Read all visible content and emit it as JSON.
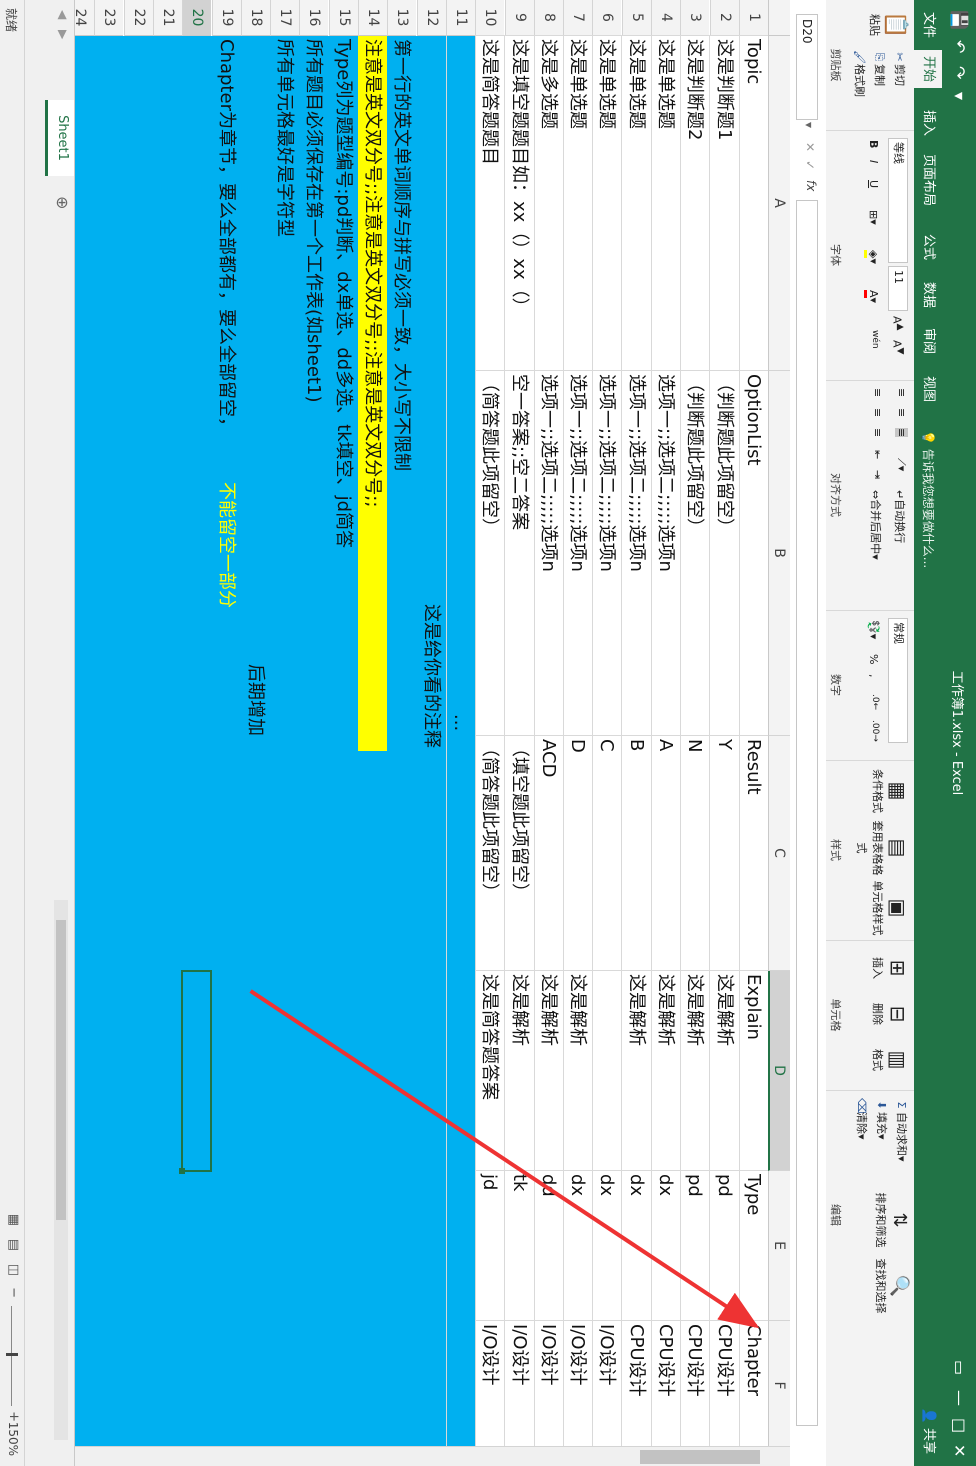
{
  "window": {
    "title": "工作簿1.xlsx - Excel",
    "share_label": "共享"
  },
  "tabs": [
    "文件",
    "开始",
    "插入",
    "页面布局",
    "公式",
    "数据",
    "审阅",
    "视图"
  ],
  "tell_me": "告诉我您想要做什么...",
  "ribbon": {
    "clipboard": {
      "paste": "粘贴",
      "cut": "剪切",
      "copy": "复制",
      "format_painter": "格式刷",
      "label": "剪贴板"
    },
    "font": {
      "name": "等线",
      "size": "11",
      "label": "字体",
      "bold": "B",
      "italic": "I",
      "underline": "U",
      "wen": "wén"
    },
    "alignment": {
      "wrap": "自动换行",
      "merge": "合并后居中",
      "label": "对齐方式"
    },
    "number": {
      "format": "常规",
      "label": "数字"
    },
    "styles": {
      "conditional": "条件格式",
      "table": "套用表格格式",
      "cell": "单元格样式",
      "label": "样式"
    },
    "cells": {
      "insert": "插入",
      "delete": "删除",
      "format": "格式",
      "label": "单元格"
    },
    "editing": {
      "autosum": "自动求和",
      "fill": "填充",
      "clear": "清除",
      "sort": "排序和筛选",
      "find": "查找和选择",
      "label": "编辑"
    }
  },
  "formula_bar": {
    "name_box": "D20",
    "fx": "fx",
    "value": ""
  },
  "columns": [
    "A",
    "B",
    "C",
    "D",
    "E",
    "F"
  ],
  "selected_column": "D",
  "rows": [
    "1",
    "2",
    "3",
    "4",
    "5",
    "6",
    "7",
    "8",
    "9",
    "10",
    "11",
    "12",
    "13",
    "14",
    "15",
    "16",
    "17",
    "18",
    "19",
    "20",
    "21",
    "22",
    "23",
    "24"
  ],
  "selected_row": "20",
  "table": {
    "header": [
      "Topic",
      "OptionList",
      "Result",
      "Explain",
      "Type",
      "Chapter"
    ],
    "data": [
      [
        "这是判断题1",
        "（判断题此项留空）",
        "Y",
        "这是解析",
        "pd",
        "CPU设计"
      ],
      [
        "这是判断题2",
        "（判断题此项留空）",
        "N",
        "这是解析",
        "pd",
        "CPU设计"
      ],
      [
        "这是单选题",
        "选项一;;选项二;;;;;选项n",
        "A",
        "这是解析",
        "dx",
        "CPU设计"
      ],
      [
        "这是单选题",
        "选项一;;选项二;;;;;选项n",
        "B",
        "这是解析",
        "dx",
        "CPU设计"
      ],
      [
        "这是单选题",
        "选项一;;选项二;;;;;选项n",
        "C",
        "",
        "dx",
        "I/O设计"
      ],
      [
        "这是单选题",
        "选项一;;选项二;;;;;选项n",
        "D",
        "这是解析",
        "dx",
        "I/O设计"
      ],
      [
        "这是多选题",
        "选项一;;选项二;;;;;选项n",
        "ACD",
        "这是解析",
        "dd",
        "I/O设计"
      ],
      [
        "这是填空题题目如：xx（）xx（）",
        "空一答案;;空二答案",
        "（填空题此项留空）",
        "这是解析",
        "tk",
        "I/O设计"
      ],
      [
        "这是简答题题目",
        "（简答题此项留空）",
        "（简答题此项留空）",
        "这是简答题答案",
        "jd",
        "I/O设计"
      ]
    ],
    "ellipsis": "...",
    "note_header": "这是给你看的注释",
    "notes": [
      "第一行的英文单词顺序与拼写必须一致，大小写不限制",
      "注意是英文双分号;;注意是英文双分号;;注意是英文双分号;;",
      "Type列为题型编号:pd判断、dx单选、dd多选、tk填空、jd简答",
      "所有题目必须保存在第一个工作表(如sheet1)",
      "所有单元格最好是字符型",
      "后期增加",
      "Chapter为章节，要么全部都有，要么全部留空，",
      "不能留空一部分"
    ]
  },
  "sheet_tab": "Sheet1",
  "status": {
    "ready": "就绪",
    "zoom": "150%"
  },
  "colors": {
    "blue_fill": "#00b0f0",
    "yellow_fill": "#ffff00",
    "excel_green": "#217346",
    "arrow_red": "#ee3333",
    "note_yellow_text": "#ffff00"
  }
}
